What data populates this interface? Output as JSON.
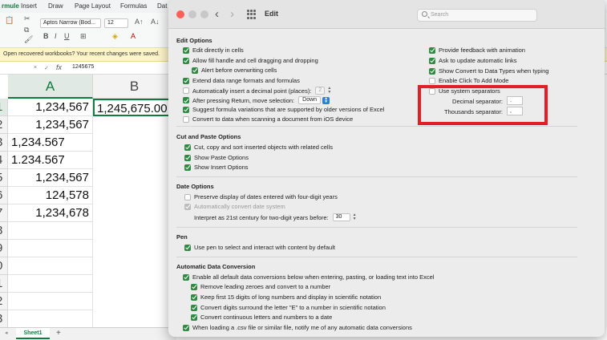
{
  "excel": {
    "ribbon_tabs": [
      "rmule",
      "Insert",
      "Draw",
      "Page Layout",
      "Formulas",
      "Dat"
    ],
    "font_name": "Aptos Narrow (Bod...",
    "font_size": "12",
    "notice_text": "Open recovered workbooks?   Your recent changes were saved.",
    "formula_value": "1245675",
    "formula_fx": "fx",
    "columns": [
      "A",
      "B"
    ],
    "rows": [
      "1",
      "2",
      "3",
      "4",
      "5",
      "6",
      "7",
      "8",
      "9",
      "0",
      "1",
      "2",
      "3",
      "4",
      "5"
    ],
    "cells_a": [
      "1,234,567",
      "1,234,567",
      "1,234.567",
      "1.234.567",
      "1,234,567",
      "124,578",
      "1,234,678"
    ],
    "cell_b1": "1,245,675.00",
    "sheet_tab": "Sheet1",
    "add_sheet": "+"
  },
  "prefs": {
    "title": "Edit",
    "search_placeholder": "Search",
    "edit_options": {
      "title": "Edit Options",
      "left": [
        {
          "label": "Edit directly in cells",
          "state": "on"
        },
        {
          "label": "Allow fill handle and cell dragging and dropping",
          "state": "on"
        },
        {
          "label": "Alert before overwriting cells",
          "state": "on"
        },
        {
          "label": "Extend data range formats and formulas",
          "state": "on"
        },
        {
          "label": "Automatically insert a decimal point (places):",
          "state": "off"
        },
        {
          "label": "After pressing Return, move selection:",
          "state": "on"
        },
        {
          "label": "Suggest formula variations that are supported by older versions of Excel",
          "state": "on"
        },
        {
          "label": "Convert to data when scanning a document from iOS device",
          "state": "off"
        }
      ],
      "decimal_places": "2",
      "move_direction": "Down",
      "right": [
        {
          "label": "Provide feedback with animation",
          "state": "on"
        },
        {
          "label": "Ask to update automatic links",
          "state": "on"
        },
        {
          "label": "Show Convert to Data Types when typing",
          "state": "on"
        },
        {
          "label": "Enable Click To Add Mode",
          "state": "off"
        },
        {
          "label": "Use system separators",
          "state": "off"
        }
      ],
      "decimal_separator_label": "Decimal separator:",
      "decimal_separator_value": ".",
      "thousands_separator_label": "Thousands separator:",
      "thousands_separator_value": ","
    },
    "cut_paste": {
      "title": "Cut and Paste Options",
      "items": [
        {
          "label": "Cut, copy and sort inserted objects with related cells",
          "state": "on"
        },
        {
          "label": "Show Paste Options",
          "state": "on"
        },
        {
          "label": "Show Insert Options",
          "state": "on"
        }
      ]
    },
    "date_options": {
      "title": "Date Options",
      "items": [
        {
          "label": "Preserve display of dates entered with four-digit years",
          "state": "off"
        },
        {
          "label": "Automatically convert date system",
          "state": "dim"
        }
      ],
      "century_label": "Interpret as 21st century for two-digit years before:",
      "century_value": "30"
    },
    "pen": {
      "title": "Pen",
      "items": [
        {
          "label": "Use pen to select and interact with content by default",
          "state": "on"
        }
      ]
    },
    "auto_conversion": {
      "title": "Automatic Data Conversion",
      "items": [
        {
          "label": "Enable all default data conversions below when entering, pasting, or loading text into Excel",
          "state": "on"
        },
        {
          "label": "Remove leading zeroes and convert to a number",
          "state": "on"
        },
        {
          "label": "Keep first 15 digits of long numbers and display in scientific notation",
          "state": "on"
        },
        {
          "label": "Convert digits surround the letter \"E\" to a number in scientific notation",
          "state": "on"
        },
        {
          "label": "Convert continuous letters and numbers to a date",
          "state": "on"
        },
        {
          "label": "When loading a .csv file or similar file, notify me of any automatic data conversions",
          "state": "on"
        }
      ]
    }
  },
  "colors": {
    "checkbox_on": "#2f8a43",
    "highlight": "#e41e26",
    "excel_green": "#107c41"
  }
}
